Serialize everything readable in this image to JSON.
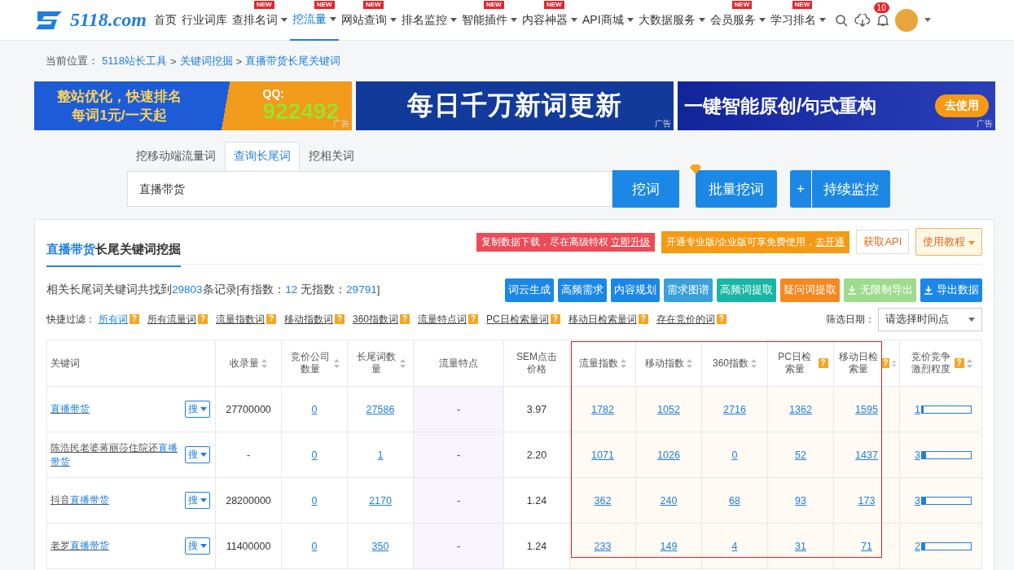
{
  "logo": {
    "text": "5118.com"
  },
  "nav": [
    {
      "label": "首页",
      "caret": false,
      "selected": false
    },
    {
      "label": "行业词库",
      "caret": false,
      "selected": false
    },
    {
      "label": "查排名词",
      "badge": "NEW",
      "caret": true,
      "selected": false
    },
    {
      "label": "挖流量",
      "badge": "NEW",
      "caret": true,
      "selected": true
    },
    {
      "label": "网站查询",
      "badge": "NEW",
      "caret": true,
      "selected": false
    },
    {
      "label": "排名监控",
      "caret": true,
      "selected": false
    },
    {
      "label": "智能插件",
      "badge": "NEW",
      "caret": true,
      "selected": false
    },
    {
      "label": "内容神器",
      "badge": "NEW",
      "caret": true,
      "selected": false
    },
    {
      "label": "API商城",
      "caret": true,
      "selected": false
    },
    {
      "label": "大数据服务",
      "caret": true,
      "selected": false
    },
    {
      "label": "会员服务",
      "badge": "NEW",
      "caret": true,
      "selected": false
    },
    {
      "label": "学习排名",
      "badge": "NEW",
      "caret": true,
      "selected": false
    }
  ],
  "notifications": {
    "count": "10"
  },
  "breadcrumb": {
    "label": "当前位置：",
    "links": [
      "5118站长工具",
      "关键词挖掘",
      "直播带货长尾关键词"
    ],
    "separator": ">"
  },
  "banners": [
    {
      "kind": "orange",
      "lines": [
        "整站优化，快速排名",
        "每词1元/一天起"
      ],
      "qq_label": "QQ:",
      "qq": "922492",
      "ad": "广告"
    },
    {
      "kind": "blue",
      "lines": [
        "每日千万新词更新"
      ],
      "ad": "广告"
    },
    {
      "kind": "action",
      "lines": [
        "一键智能原创/句式重构"
      ],
      "button": "去使用",
      "ad": "广告"
    }
  ],
  "search_tabs": [
    {
      "label": "挖移动端流量词",
      "selected": false
    },
    {
      "label": "查询长尾词",
      "selected": true
    },
    {
      "label": "挖相关词",
      "selected": false
    }
  ],
  "search": {
    "value": "直播带货",
    "button": "挖词",
    "batch_button": "批量挖词",
    "monitor_plus": "+",
    "monitor_button": "持续监控"
  },
  "panel": {
    "title_keyword": "直播带货",
    "title_rest": "长尾关键词挖掘",
    "upgrade_notice": "复制数据下载，尽在高级特权",
    "upgrade_link": "立即升级",
    "vip_notice": "开通专业版/企业版可享免费使用，",
    "vip_link": "去开通",
    "api_button": "获取API",
    "tutorial_button": "使用教程"
  },
  "summary": {
    "prefix": "相关长尾词关键词共找到",
    "total": "29803",
    "middle": "条记录[有指数：",
    "with_index": "12",
    "middle2": " 无指数：",
    "without_index": "29791",
    "suffix": "]"
  },
  "tools": [
    {
      "label": "词云生成",
      "color": "#1b88e6"
    },
    {
      "label": "高频需求",
      "color": "#1b88e6"
    },
    {
      "label": "内容规划",
      "color": "#1b88e6"
    },
    {
      "label": "需求图谱",
      "color": "#3aa0d8"
    },
    {
      "label": "高频词提取",
      "color": "#19b6a5"
    },
    {
      "label": "疑问词提取",
      "color": "#f5891f"
    },
    {
      "label": "无限制导出",
      "color": "#9fdb8e"
    },
    {
      "label": "导出数据",
      "color": "#1b88e6"
    }
  ],
  "filters": {
    "label": "快捷过滤：",
    "items": [
      {
        "label": "所有词",
        "selected": true,
        "help": "?"
      },
      {
        "label": "所有流量词",
        "selected": false,
        "help": "?"
      },
      {
        "label": "流量指数词",
        "selected": false,
        "help": "?"
      },
      {
        "label": "移动指数词",
        "selected": false,
        "help": "?"
      },
      {
        "label": "360指数词",
        "selected": false,
        "help": "?"
      },
      {
        "label": "流量特点词",
        "selected": false,
        "help": "?"
      },
      {
        "label": "PC日检索量词",
        "selected": false,
        "help": "?"
      },
      {
        "label": "移动日检索量词",
        "selected": false,
        "help": "?"
      },
      {
        "label": "存在竞价的词",
        "selected": false,
        "help": "?"
      }
    ],
    "date_label": "筛选日期：",
    "date_placeholder": "请选择时间点"
  },
  "table": {
    "columns": [
      {
        "label": "关键词",
        "sortable": false
      },
      {
        "label": "收录量",
        "sortable": true
      },
      {
        "label": "竞价公司数量",
        "sortable": true
      },
      {
        "label": "长尾词数量",
        "sortable": true
      },
      {
        "label": "流量特点",
        "sortable": false
      },
      {
        "label": "SEM点击价格",
        "sortable": false
      },
      {
        "label": "流量指数",
        "sortable": true
      },
      {
        "label": "移动指数",
        "sortable": true
      },
      {
        "label": "360指数",
        "sortable": true
      },
      {
        "label": "PC日检索量",
        "sortable": false,
        "help": "?"
      },
      {
        "label": "移动日检索量",
        "sortable": true,
        "help": "?"
      },
      {
        "label": "竞价竞争激烈程度",
        "sortable": true,
        "help": "?"
      }
    ],
    "rows": [
      {
        "search_button": "搜",
        "match": "直播带货",
        "indexed": "27700000",
        "companies": "0",
        "longtail": "27586",
        "feature": "-",
        "sem": "3.97",
        "flow": "1782",
        "mobile": "1052",
        "i360": "2716",
        "pc_daily": "1362",
        "mobile_daily": "1595",
        "competition": "1",
        "level": 0.04
      },
      {
        "search_button": "搜",
        "prefix": "陈浩民老婆蒋丽莎住院还",
        "match": "直播带货",
        "indexed": "-",
        "companies": "0",
        "longtail": "1",
        "feature": "-",
        "sem": "2.20",
        "flow": "1071",
        "mobile": "1026",
        "i360": "0",
        "pc_daily": "52",
        "mobile_daily": "1437",
        "competition": "3",
        "level": 0.08
      },
      {
        "search_button": "搜",
        "prefix": "抖音",
        "match": "直播带货",
        "indexed": "28200000",
        "companies": "0",
        "longtail": "2170",
        "feature": "-",
        "sem": "1.24",
        "flow": "362",
        "mobile": "240",
        "i360": "68",
        "pc_daily": "93",
        "mobile_daily": "173",
        "competition": "3",
        "level": 0.08
      },
      {
        "search_button": "搜",
        "prefix": "老罗",
        "match": "直播带货",
        "indexed": "11400000",
        "companies": "0",
        "longtail": "350",
        "feature": "-",
        "sem": "1.24",
        "flow": "233",
        "mobile": "149",
        "i360": "4",
        "pc_daily": "31",
        "mobile_daily": "71",
        "competition": "2",
        "level": 0.06
      }
    ]
  }
}
